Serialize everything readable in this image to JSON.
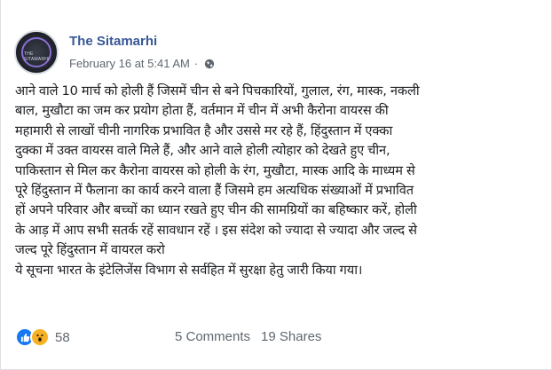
{
  "post": {
    "page_name": "The Sitamarhi",
    "date": "February 16 at 5:41 AM",
    "separator": "·",
    "privacy_icon": "globe-icon",
    "avatar_caption": "THE SITAMARHI",
    "text_lines": [
      "आने वाले 10 मार्च को होली हैं जिसमें चीन से बने पिचकारियों, गुलाल, रंग, मास्क, नकली",
      "बाल, मुखौटा का जम कर प्रयोग होता हैं, वर्तमान में चीन में अभी कैरोना वायरस की",
      "महामारी से लाखों चीनी नागरिक प्रभावित है और उससे मर रहे हैं, हिंदुस्तान में एक्का",
      "दुक्का में उक्त वायरस वाले मिले हैं, और आने वाले होली त्योहार को देखते हुए चीन,",
      "पाकिस्तान से मिल कर कैरोना वायरस को होली के रंग, मुखौटा, मास्क आदि के माध्यम से",
      "पूरे हिंदुस्तान में फैलाना का कार्य करने वाला हैं जिसमे हम अत्यधिक संख्याओं में प्रभावित",
      "हों अपने परिवार और बच्चों का ध्यान रखते हुए चीन की सामग्रियों का बहिष्कार करें, होली",
      "के आड़ में आप सभी सतर्क रहें सावधान रहें । इस संदेश को ज्यादा से ज्यादा और जल्द से",
      "जल्द पूरे हिंदुस्तान में वायरल करो",
      "ये सूचना भारत के इंटेलिजेंस विभाग से सर्वहित में सुरक्षा हेतु जारी किया गया।"
    ]
  },
  "stats": {
    "reaction_icons": [
      "like-icon",
      "wow-icon"
    ],
    "reaction_count": "58",
    "comments": "5 Comments",
    "shares": "19 Shares"
  },
  "colors": {
    "page_name": "#385898",
    "like": "#1877f2",
    "wow": "#f7b125",
    "meta": "#606770"
  }
}
